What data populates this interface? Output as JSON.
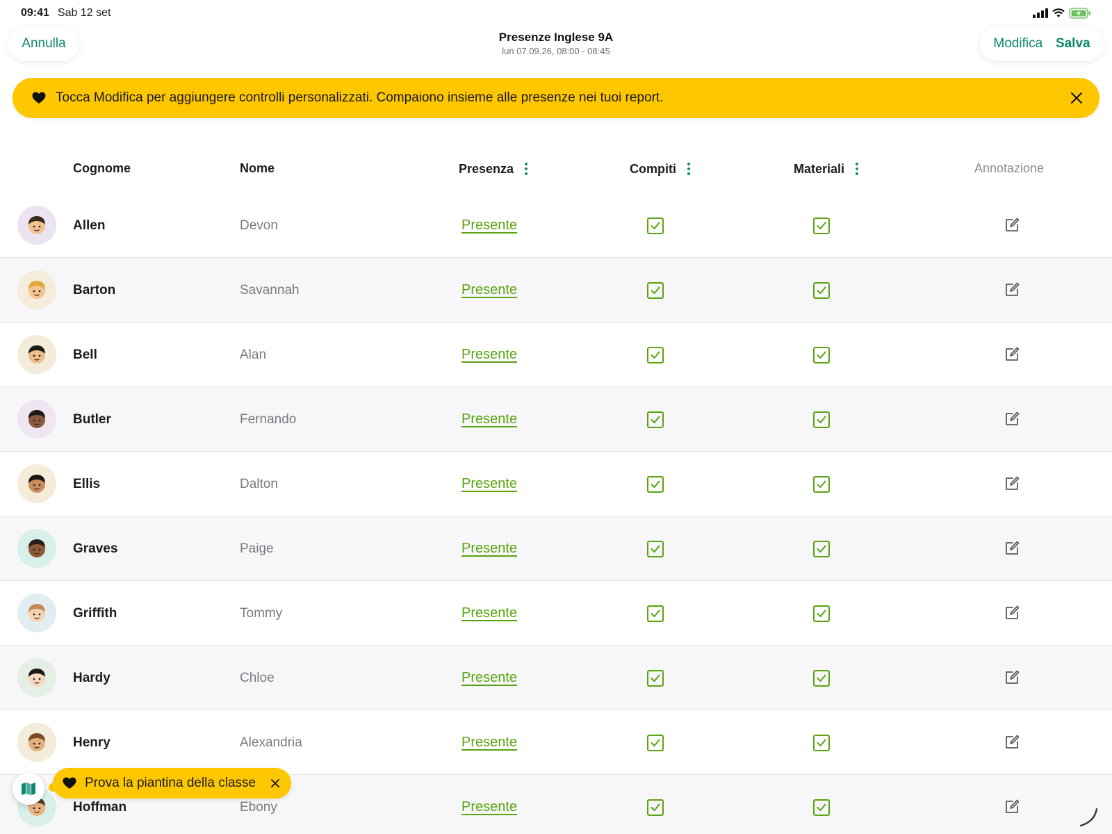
{
  "status_bar": {
    "time": "09:41",
    "date": "Sab 12 set"
  },
  "nav": {
    "cancel_label": "Annulla",
    "title": "Presenze Inglese 9A",
    "subtitle": "lun 07.09.26, 08:00 - 08:45",
    "edit_label": "Modifica",
    "save_label": "Salva"
  },
  "banner": {
    "text": "Tocca Modifica per aggiungere controlli personalizzati. Compaiono insieme alle presenze nei tuoi report."
  },
  "columns": {
    "last_name": "Cognome",
    "first_name": "Nome",
    "attendance": "Presenza",
    "homework": "Compiti",
    "materials": "Materiali",
    "annotation": "Annotazione"
  },
  "rows": [
    {
      "last": "Allen",
      "first": "Devon",
      "status": "Presente",
      "homework": true,
      "materials": true,
      "avatar_bg": "#ece3f1",
      "skin": "#f2c190",
      "hair": "#3a2a1e"
    },
    {
      "last": "Barton",
      "first": "Savannah",
      "status": "Presente",
      "homework": true,
      "materials": true,
      "avatar_bg": "#f5ecdc",
      "skin": "#f3c590",
      "hair": "#e0a93a"
    },
    {
      "last": "Bell",
      "first": "Alan",
      "status": "Presente",
      "homework": true,
      "materials": true,
      "avatar_bg": "#f3ecda",
      "skin": "#efbc8a",
      "hair": "#1e1a17"
    },
    {
      "last": "Butler",
      "first": "Fernando",
      "status": "Presente",
      "homework": true,
      "materials": true,
      "avatar_bg": "#efe6f2",
      "skin": "#8b5a3c",
      "hair": "#1e1a17"
    },
    {
      "last": "Ellis",
      "first": "Dalton",
      "status": "Presente",
      "homework": true,
      "materials": true,
      "avatar_bg": "#f4ecd9",
      "skin": "#c98d5b",
      "hair": "#1a1714"
    },
    {
      "last": "Graves",
      "first": "Paige",
      "status": "Presente",
      "homework": true,
      "materials": true,
      "avatar_bg": "#d8efea",
      "skin": "#8e5a37",
      "hair": "#2a1e17"
    },
    {
      "last": "Griffith",
      "first": "Tommy",
      "status": "Presente",
      "homework": true,
      "materials": true,
      "avatar_bg": "#e2edf2",
      "skin": "#f6d3b3",
      "hair": "#c88a54"
    },
    {
      "last": "Hardy",
      "first": "Chloe",
      "status": "Presente",
      "homework": true,
      "materials": true,
      "avatar_bg": "#e5efe6",
      "skin": "#f7d9be",
      "hair": "#1e1a17"
    },
    {
      "last": "Henry",
      "first": "Alexandria",
      "status": "Presente",
      "homework": true,
      "materials": true,
      "avatar_bg": "#f3ecda",
      "skin": "#e6b07e",
      "hair": "#7a4e2a"
    },
    {
      "last": "Hoffman",
      "first": "Ebony",
      "status": "Presente",
      "homework": true,
      "materials": true,
      "avatar_bg": "#d9efea",
      "skin": "#e9b483",
      "hair": "#5a3a22"
    }
  ],
  "classroom_tip": {
    "text": "Prova la piantina della classe"
  },
  "colors": {
    "accent": "#0d8a6e",
    "present": "#5aa30f",
    "banner": "#ffc700"
  }
}
